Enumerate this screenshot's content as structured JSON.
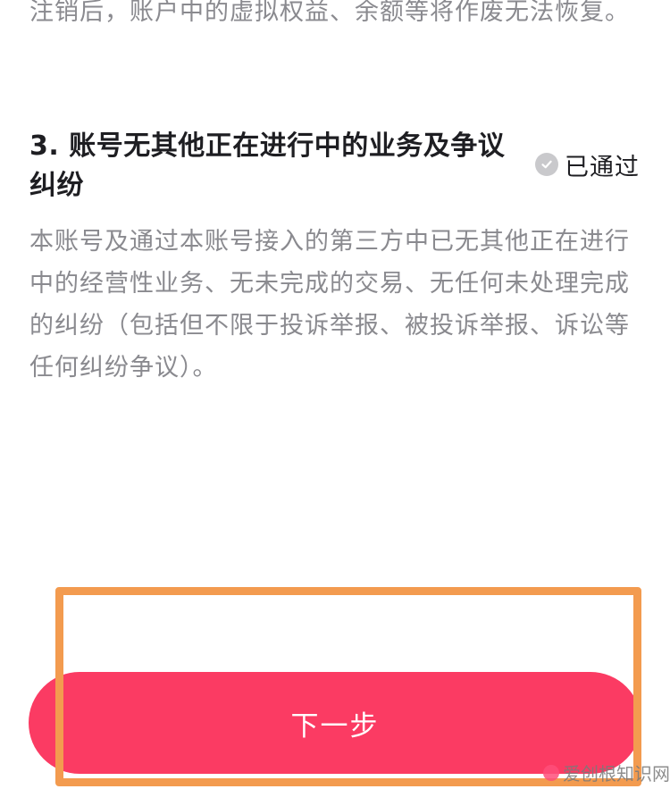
{
  "intro": {
    "text": "注销后，账户中的虚拟权益、余额等将作废无法恢复。"
  },
  "section3": {
    "title": "3. 账号无其他正在进行中的业务及争议纠纷",
    "status": "已通过",
    "status_icon": "check-circle-icon",
    "description": "本账号及通过本账号接入的第三方中已无其他正在进行中的经营性业务、无未完成的交易、无任何未处理完成的纠纷（包括但不限于投诉举报、被投诉举报、诉讼等任何纠纷争议）。"
  },
  "next_button": {
    "label": "下一步"
  },
  "watermark": {
    "text": "爱创根知识网"
  },
  "colors": {
    "accent": "#fb3b63",
    "highlight": "#f39b4f",
    "muted_text": "#8a8a8f",
    "check_bg": "#c9c9cc"
  }
}
